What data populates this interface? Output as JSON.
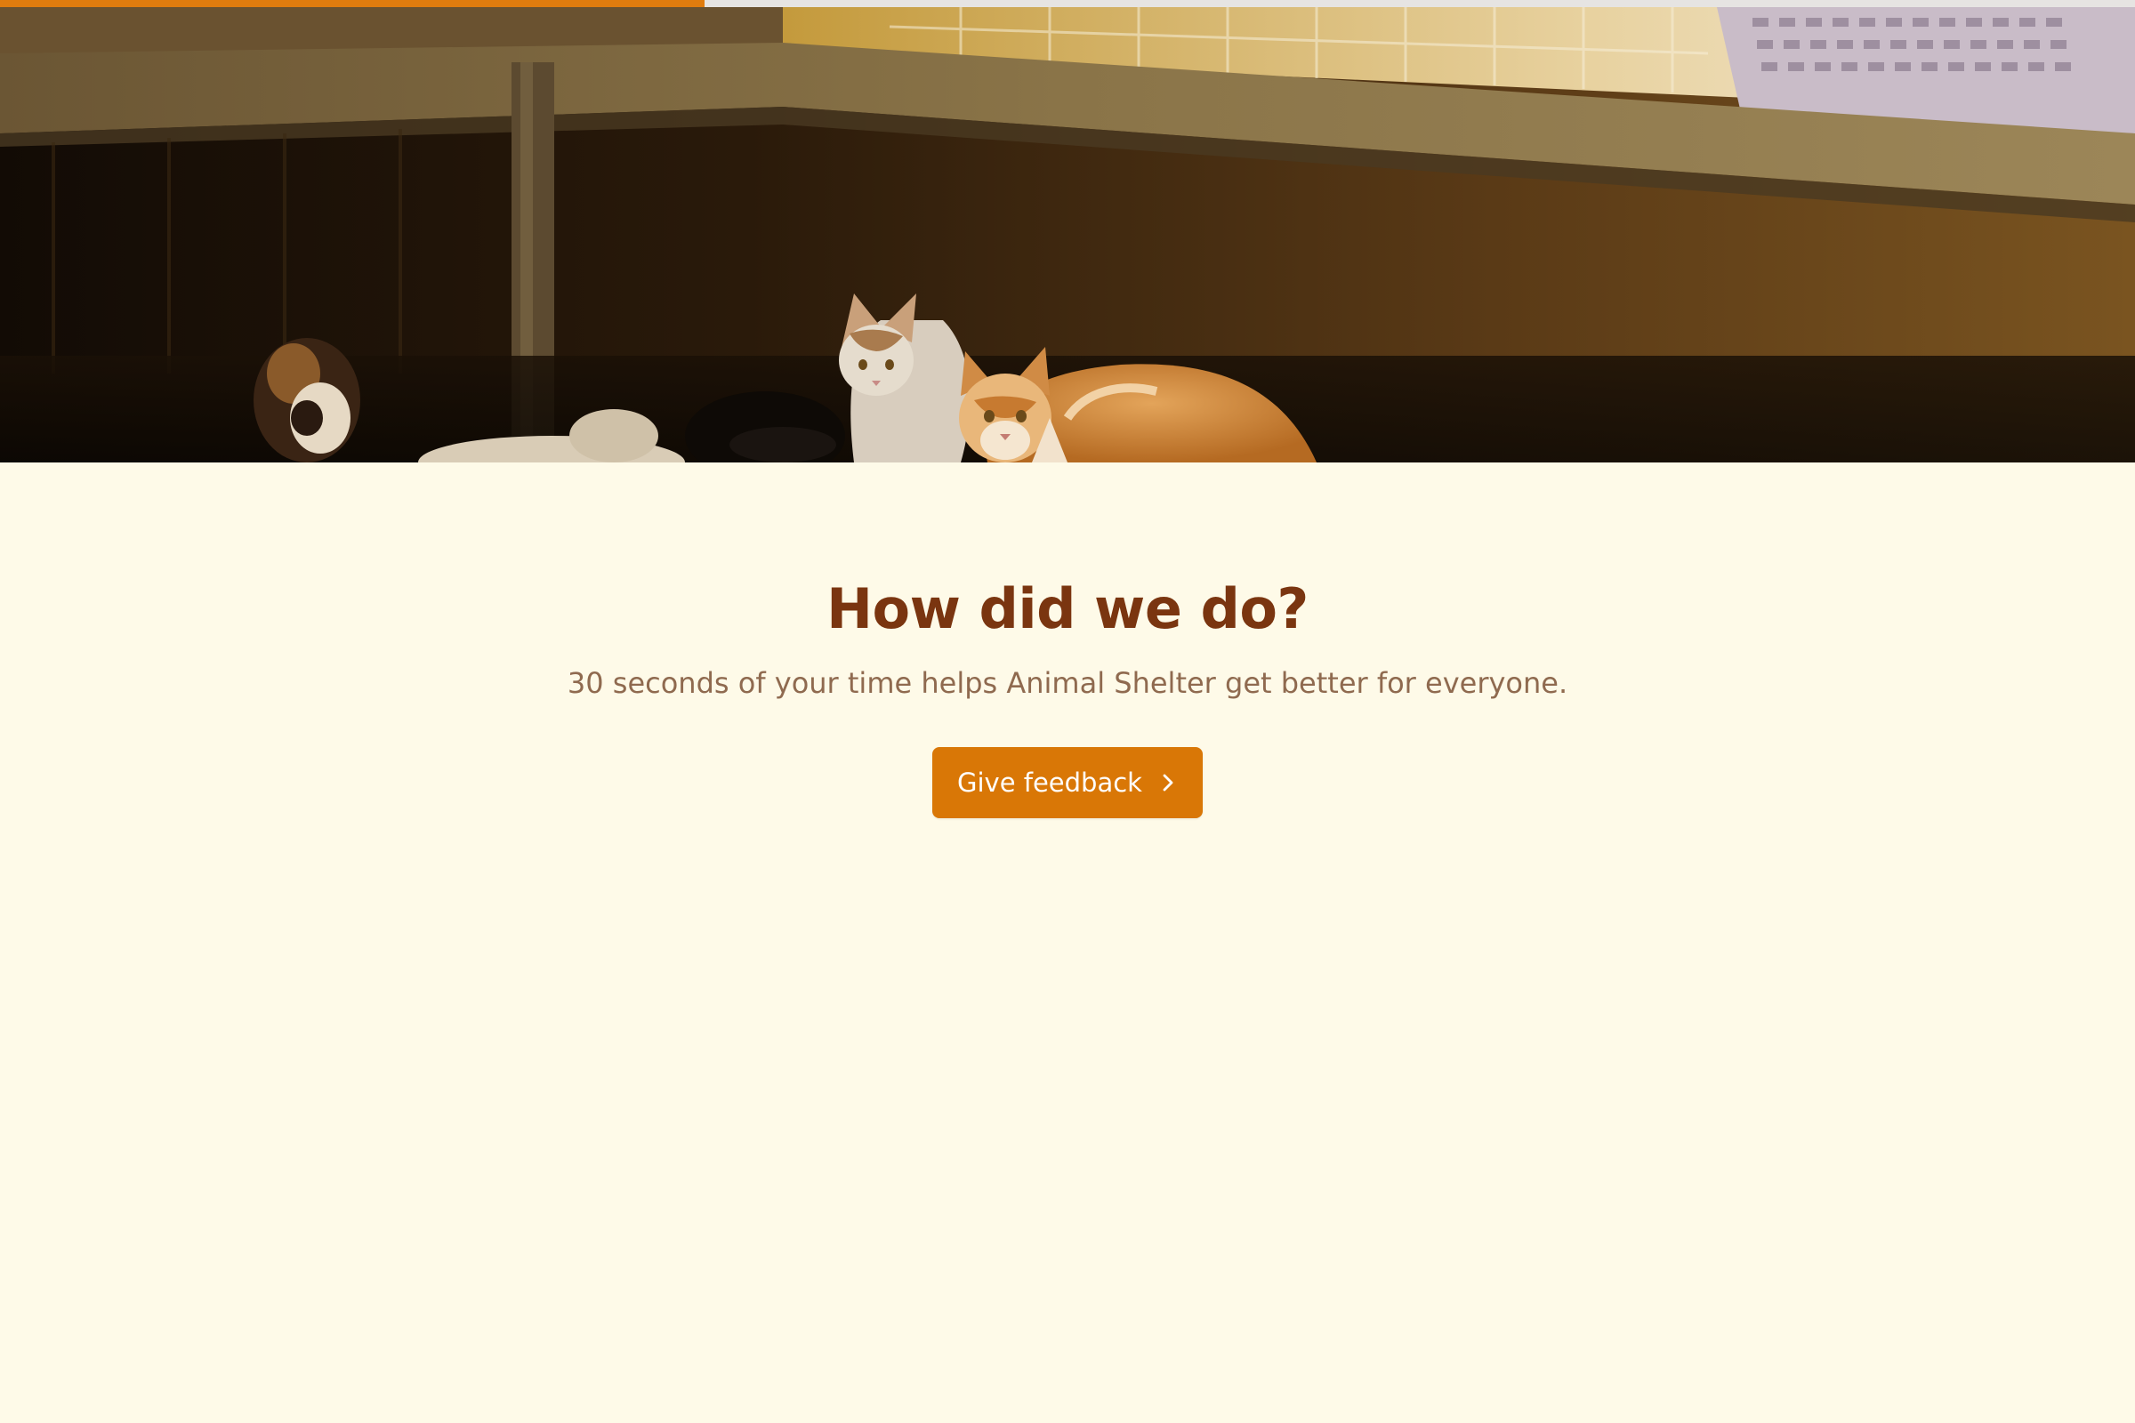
{
  "progress": {
    "fraction": 0.33,
    "fill_color": "#E07C0E",
    "track_color": "#E6E4E2"
  },
  "hero": {
    "image": "cats-in-shelter-photo"
  },
  "feedback": {
    "title": "How did we do?",
    "subtitle": "30 seconds of your time helps Animal Shelter get better for everyone.",
    "button_label": "Give feedback",
    "button_icon": "chevron-right-icon"
  },
  "colors": {
    "background": "#FEFAE8",
    "title": "#7A3510",
    "subtitle": "#8F6A4F",
    "accent": "#D97706"
  }
}
